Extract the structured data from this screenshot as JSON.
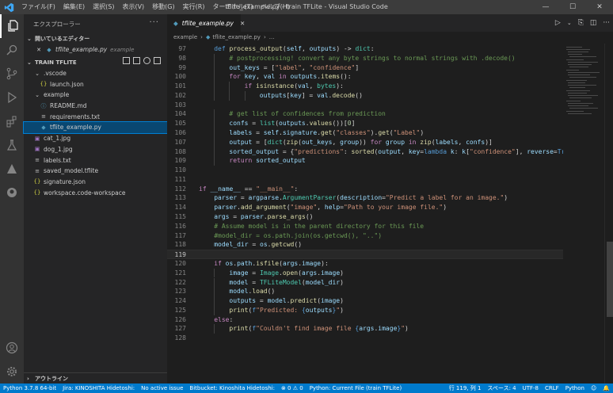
{
  "window": {
    "title": "tflite_example.py - train TFLite - Visual Studio Code",
    "menu": [
      "ファイル(F)",
      "編集(E)",
      "選択(S)",
      "表示(V)",
      "移動(G)",
      "実行(R)",
      "ターミナル(T)",
      "ヘルプ(H)"
    ]
  },
  "sidebar": {
    "title": "エクスプローラー",
    "open_editors_label": "開いているエディター",
    "open_editor": {
      "name": "tflite_example.py",
      "folder": "example"
    },
    "project_label": "TRAIN TFLITE",
    "tree": [
      {
        "label": ".vscode",
        "type": "folder",
        "depth": 1
      },
      {
        "label": "launch.json",
        "type": "json",
        "depth": 2
      },
      {
        "label": "example",
        "type": "folder",
        "depth": 1
      },
      {
        "label": "README.md",
        "type": "md",
        "depth": 2
      },
      {
        "label": "requirements.txt",
        "type": "txt",
        "depth": 2
      },
      {
        "label": "tflite_example.py",
        "type": "py",
        "depth": 2,
        "selected": true
      },
      {
        "label": "cat_1.jpg",
        "type": "img",
        "depth": 1
      },
      {
        "label": "dog_1.jpg",
        "type": "img",
        "depth": 1
      },
      {
        "label": "labels.txt",
        "type": "txt",
        "depth": 1
      },
      {
        "label": "saved_model.tflite",
        "type": "txt",
        "depth": 1
      },
      {
        "label": "signature.json",
        "type": "json",
        "depth": 1
      },
      {
        "label": "workspace.code-workspace",
        "type": "json",
        "depth": 1
      }
    ],
    "outline_label": "アウトライン"
  },
  "editor": {
    "tab_label": "tflite_example.py",
    "breadcrumb": [
      "example",
      "tflite_example.py",
      "..."
    ],
    "current_line": 119,
    "lines": [
      {
        "n": 97,
        "indent": 1,
        "tokens": [
          [
            "kw",
            "def "
          ],
          [
            "fn",
            "process_output"
          ],
          [
            "pl",
            "("
          ],
          [
            "vr",
            "self"
          ],
          [
            "pl",
            ", "
          ],
          [
            "vr",
            "outputs"
          ],
          [
            "pl",
            ") -> "
          ],
          [
            "cls",
            "dict"
          ],
          [
            "pl",
            ":"
          ]
        ]
      },
      {
        "n": 98,
        "indent": 2,
        "tokens": [
          [
            "cm",
            "# postprocessing! convert any byte strings to normal strings with .decode()"
          ]
        ]
      },
      {
        "n": 99,
        "indent": 2,
        "tokens": [
          [
            "vr",
            "out_keys"
          ],
          [
            "pl",
            " = ["
          ],
          [
            "str",
            "\"label\""
          ],
          [
            "pl",
            ", "
          ],
          [
            "str",
            "\"confidence\""
          ],
          [
            "pl",
            "]"
          ]
        ]
      },
      {
        "n": 100,
        "indent": 2,
        "tokens": [
          [
            "kc",
            "for "
          ],
          [
            "vr",
            "key"
          ],
          [
            "pl",
            ", "
          ],
          [
            "vr",
            "val"
          ],
          [
            "kc",
            " in "
          ],
          [
            "vr",
            "outputs"
          ],
          [
            "pl",
            "."
          ],
          [
            "fn",
            "items"
          ],
          [
            "pl",
            "():"
          ]
        ]
      },
      {
        "n": 101,
        "indent": 3,
        "tokens": [
          [
            "kc",
            "if "
          ],
          [
            "fn",
            "isinstance"
          ],
          [
            "pl",
            "("
          ],
          [
            "vr",
            "val"
          ],
          [
            "pl",
            ", "
          ],
          [
            "cls",
            "bytes"
          ],
          [
            "pl",
            "):"
          ]
        ]
      },
      {
        "n": 102,
        "indent": 4,
        "tokens": [
          [
            "vr",
            "outputs"
          ],
          [
            "pl",
            "["
          ],
          [
            "vr",
            "key"
          ],
          [
            "pl",
            "] = "
          ],
          [
            "vr",
            "val"
          ],
          [
            "pl",
            "."
          ],
          [
            "fn",
            "decode"
          ],
          [
            "pl",
            "()"
          ]
        ]
      },
      {
        "n": 103,
        "indent": 0,
        "tokens": []
      },
      {
        "n": 104,
        "indent": 2,
        "tokens": [
          [
            "cm",
            "# get list of confidences from prediction"
          ]
        ]
      },
      {
        "n": 105,
        "indent": 2,
        "tokens": [
          [
            "vr",
            "confs"
          ],
          [
            "pl",
            " = "
          ],
          [
            "cls",
            "list"
          ],
          [
            "pl",
            "("
          ],
          [
            "vr",
            "outputs"
          ],
          [
            "pl",
            "."
          ],
          [
            "fn",
            "values"
          ],
          [
            "pl",
            "())["
          ],
          [
            "num",
            "0"
          ],
          [
            "pl",
            "]"
          ]
        ]
      },
      {
        "n": 106,
        "indent": 2,
        "tokens": [
          [
            "vr",
            "labels"
          ],
          [
            "pl",
            " = "
          ],
          [
            "vr",
            "self"
          ],
          [
            "pl",
            "."
          ],
          [
            "vr",
            "signature"
          ],
          [
            "pl",
            "."
          ],
          [
            "fn",
            "get"
          ],
          [
            "pl",
            "("
          ],
          [
            "str",
            "\"classes\""
          ],
          [
            "pl",
            ")."
          ],
          [
            "fn",
            "get"
          ],
          [
            "pl",
            "("
          ],
          [
            "str",
            "\"Label\""
          ],
          [
            "pl",
            ")"
          ]
        ]
      },
      {
        "n": 107,
        "indent": 2,
        "tokens": [
          [
            "vr",
            "output"
          ],
          [
            "pl",
            " = ["
          ],
          [
            "cls",
            "dict"
          ],
          [
            "pl",
            "("
          ],
          [
            "fn",
            "zip"
          ],
          [
            "pl",
            "("
          ],
          [
            "vr",
            "out_keys"
          ],
          [
            "pl",
            ", "
          ],
          [
            "vr",
            "group"
          ],
          [
            "pl",
            ")) "
          ],
          [
            "kc",
            "for "
          ],
          [
            "vr",
            "group"
          ],
          [
            "kc",
            " in "
          ],
          [
            "fn",
            "zip"
          ],
          [
            "pl",
            "("
          ],
          [
            "vr",
            "labels"
          ],
          [
            "pl",
            ", "
          ],
          [
            "vr",
            "confs"
          ],
          [
            "pl",
            ")]"
          ]
        ]
      },
      {
        "n": 108,
        "indent": 2,
        "tokens": [
          [
            "vr",
            "sorted_output"
          ],
          [
            "pl",
            " = {"
          ],
          [
            "str",
            "\"predictions\""
          ],
          [
            "pl",
            ": "
          ],
          [
            "fn",
            "sorted"
          ],
          [
            "pl",
            "("
          ],
          [
            "vr",
            "output"
          ],
          [
            "pl",
            ", "
          ],
          [
            "vr",
            "key"
          ],
          [
            "pl",
            "="
          ],
          [
            "kw",
            "lambda "
          ],
          [
            "vr",
            "k"
          ],
          [
            "pl",
            ": "
          ],
          [
            "vr",
            "k"
          ],
          [
            "pl",
            "["
          ],
          [
            "str",
            "\"confidence\""
          ],
          [
            "pl",
            "], "
          ],
          [
            "vr",
            "reverse"
          ],
          [
            "pl",
            "="
          ],
          [
            "kw",
            "Tr"
          ]
        ]
      },
      {
        "n": 109,
        "indent": 2,
        "tokens": [
          [
            "kc",
            "return "
          ],
          [
            "vr",
            "sorted_output"
          ]
        ]
      },
      {
        "n": 110,
        "indent": 0,
        "tokens": []
      },
      {
        "n": 111,
        "indent": 0,
        "tokens": []
      },
      {
        "n": 112,
        "indent": 0,
        "tokens": [
          [
            "kc",
            "if "
          ],
          [
            "vr",
            "__name__"
          ],
          [
            "pl",
            " == "
          ],
          [
            "str",
            "\"__main__\""
          ],
          [
            "pl",
            ":"
          ]
        ]
      },
      {
        "n": 113,
        "indent": 1,
        "tokens": [
          [
            "vr",
            "parser"
          ],
          [
            "pl",
            " = "
          ],
          [
            "vr",
            "argparse"
          ],
          [
            "pl",
            "."
          ],
          [
            "cls",
            "ArgumentParser"
          ],
          [
            "pl",
            "("
          ],
          [
            "vr",
            "description"
          ],
          [
            "pl",
            "="
          ],
          [
            "str",
            "\"Predict a label for an image.\""
          ],
          [
            "pl",
            ")"
          ]
        ]
      },
      {
        "n": 114,
        "indent": 1,
        "tokens": [
          [
            "vr",
            "parser"
          ],
          [
            "pl",
            "."
          ],
          [
            "fn",
            "add_argument"
          ],
          [
            "pl",
            "("
          ],
          [
            "str",
            "\"image\""
          ],
          [
            "pl",
            ", "
          ],
          [
            "vr",
            "help"
          ],
          [
            "pl",
            "="
          ],
          [
            "str",
            "\"Path to your image file.\""
          ],
          [
            "pl",
            ")"
          ]
        ]
      },
      {
        "n": 115,
        "indent": 1,
        "tokens": [
          [
            "vr",
            "args"
          ],
          [
            "pl",
            " = "
          ],
          [
            "vr",
            "parser"
          ],
          [
            "pl",
            "."
          ],
          [
            "fn",
            "parse_args"
          ],
          [
            "pl",
            "()"
          ]
        ]
      },
      {
        "n": 116,
        "indent": 1,
        "tokens": [
          [
            "cm",
            "# Assume model is in the parent directory for this file"
          ]
        ]
      },
      {
        "n": 117,
        "indent": 1,
        "tokens": [
          [
            "cm",
            "#model_dir = os.path.join(os.getcwd(), \"..\")"
          ]
        ]
      },
      {
        "n": 118,
        "indent": 1,
        "tokens": [
          [
            "vr",
            "model_dir"
          ],
          [
            "pl",
            " = "
          ],
          [
            "vr",
            "os"
          ],
          [
            "pl",
            "."
          ],
          [
            "fn",
            "getcwd"
          ],
          [
            "pl",
            "()"
          ]
        ]
      },
      {
        "n": 119,
        "indent": 0,
        "tokens": []
      },
      {
        "n": 120,
        "indent": 1,
        "tokens": [
          [
            "kc",
            "if "
          ],
          [
            "vr",
            "os"
          ],
          [
            "pl",
            "."
          ],
          [
            "vr",
            "path"
          ],
          [
            "pl",
            "."
          ],
          [
            "fn",
            "isfile"
          ],
          [
            "pl",
            "("
          ],
          [
            "vr",
            "args"
          ],
          [
            "pl",
            "."
          ],
          [
            "vr",
            "image"
          ],
          [
            "pl",
            "):"
          ]
        ]
      },
      {
        "n": 121,
        "indent": 2,
        "tokens": [
          [
            "vr",
            "image"
          ],
          [
            "pl",
            " = "
          ],
          [
            "cls",
            "Image"
          ],
          [
            "pl",
            "."
          ],
          [
            "fn",
            "open"
          ],
          [
            "pl",
            "("
          ],
          [
            "vr",
            "args"
          ],
          [
            "pl",
            "."
          ],
          [
            "vr",
            "image"
          ],
          [
            "pl",
            ")"
          ]
        ]
      },
      {
        "n": 122,
        "indent": 2,
        "tokens": [
          [
            "vr",
            "model"
          ],
          [
            "pl",
            " = "
          ],
          [
            "cls",
            "TFLiteModel"
          ],
          [
            "pl",
            "("
          ],
          [
            "vr",
            "model_dir"
          ],
          [
            "pl",
            ")"
          ]
        ]
      },
      {
        "n": 123,
        "indent": 2,
        "tokens": [
          [
            "vr",
            "model"
          ],
          [
            "pl",
            "."
          ],
          [
            "fn",
            "load"
          ],
          [
            "pl",
            "()"
          ]
        ]
      },
      {
        "n": 124,
        "indent": 2,
        "tokens": [
          [
            "vr",
            "outputs"
          ],
          [
            "pl",
            " = "
          ],
          [
            "vr",
            "model"
          ],
          [
            "pl",
            "."
          ],
          [
            "fn",
            "predict"
          ],
          [
            "pl",
            "("
          ],
          [
            "vr",
            "image"
          ],
          [
            "pl",
            ")"
          ]
        ]
      },
      {
        "n": 125,
        "indent": 2,
        "tokens": [
          [
            "fn",
            "print"
          ],
          [
            "pl",
            "("
          ],
          [
            "kw",
            "f"
          ],
          [
            "str",
            "\"Predicted: "
          ],
          [
            "kw",
            "{"
          ],
          [
            "vr",
            "outputs"
          ],
          [
            "kw",
            "}"
          ],
          [
            "str",
            "\""
          ],
          [
            "pl",
            ")"
          ]
        ]
      },
      {
        "n": 126,
        "indent": 1,
        "tokens": [
          [
            "kc",
            "else"
          ],
          [
            "pl",
            ":"
          ]
        ]
      },
      {
        "n": 127,
        "indent": 2,
        "tokens": [
          [
            "fn",
            "print"
          ],
          [
            "pl",
            "("
          ],
          [
            "kw",
            "f"
          ],
          [
            "str",
            "\"Couldn't find image file "
          ],
          [
            "kw",
            "{"
          ],
          [
            "vr",
            "args"
          ],
          [
            "pl",
            "."
          ],
          [
            "vr",
            "image"
          ],
          [
            "kw",
            "}"
          ],
          [
            "str",
            "\""
          ],
          [
            "pl",
            ")"
          ]
        ]
      },
      {
        "n": 128,
        "indent": 0,
        "tokens": []
      }
    ]
  },
  "statusbar": {
    "python": "Python 3.7.8 64-bit",
    "jira": "Jira: KINOSHITA Hidetoshi:",
    "issue": "No active issue",
    "bitbucket": "Bitbucket: Kinoshita Hidetoshi:",
    "problems": "⊗ 0 ⚠ 0",
    "run_config": "Python: Current File (train TFLite)",
    "position": "行 119, 列 1",
    "spaces": "スペース: 4",
    "encoding": "UTF-8",
    "eol": "CRLF",
    "language": "Python"
  },
  "colors": {
    "accent": "#007acc",
    "selection": "#094771"
  }
}
